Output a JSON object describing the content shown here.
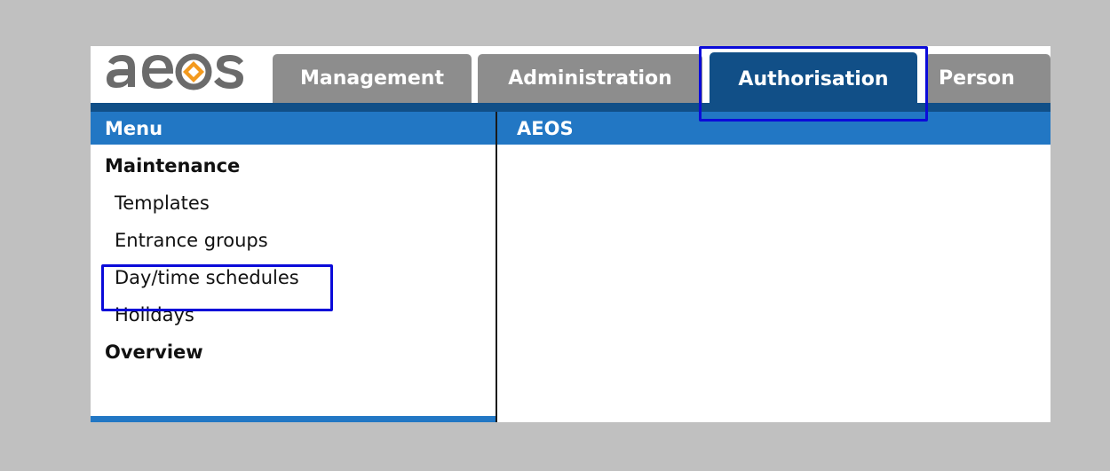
{
  "logo": {
    "text": "aeos",
    "icon": "aeos-logo"
  },
  "tabs": [
    {
      "label": "Management",
      "active": false
    },
    {
      "label": "Administration",
      "active": false
    },
    {
      "label": "Authorisation",
      "active": true
    },
    {
      "label": "Person",
      "active": false
    }
  ],
  "menu": {
    "header": "Menu",
    "sections": [
      {
        "label": "Maintenance",
        "items": [
          {
            "label": "Templates"
          },
          {
            "label": "Entrance groups"
          },
          {
            "label": "Day/time schedules",
            "highlighted": true
          },
          {
            "label": "Holidays"
          }
        ]
      },
      {
        "label": "Overview",
        "items": []
      }
    ]
  },
  "main": {
    "header": "AEOS"
  },
  "colors": {
    "background": "#c0c0c0",
    "tab_inactive": "#8d8d8d",
    "tab_active": "#114f87",
    "panel_header": "#2277c4",
    "highlight": "#0b0bd9",
    "logo_orange": "#f39a1e",
    "logo_gray": "#6b6b6b"
  }
}
